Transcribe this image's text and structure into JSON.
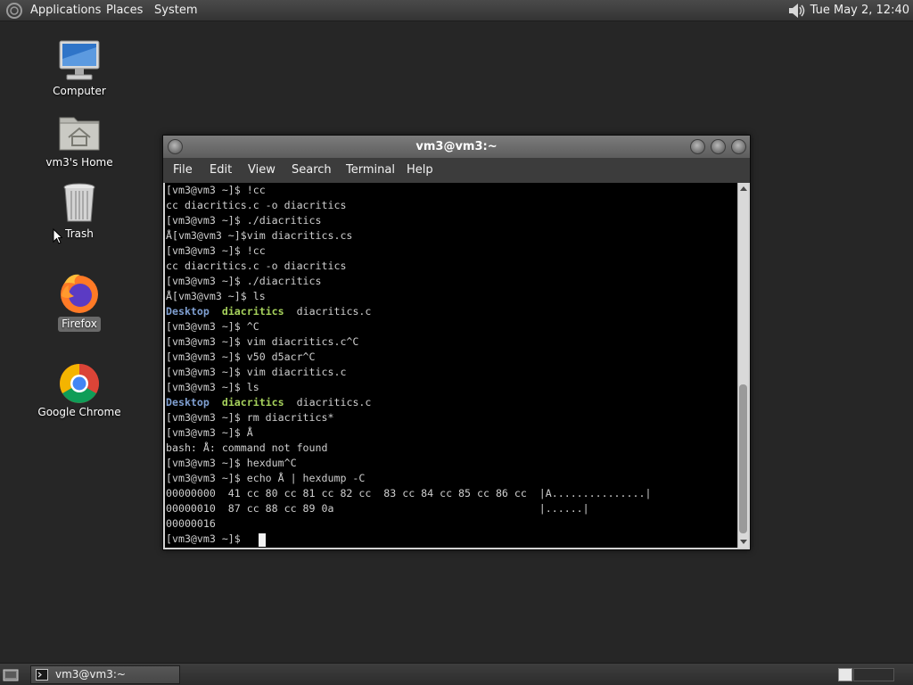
{
  "top_panel": {
    "applications": "Applications",
    "places": "Places",
    "system": "System",
    "clock": "Tue May  2, 12:40"
  },
  "desktop_icons": {
    "computer": "Computer",
    "home": "vm3's Home",
    "trash": "Trash",
    "firefox": "Firefox",
    "chrome": "Google Chrome"
  },
  "terminal": {
    "title": "vm3@vm3:~",
    "menu": [
      "File",
      "Edit",
      "View",
      "Search",
      "Terminal",
      "Help"
    ],
    "lines": [
      "[vm3@vm3 ~]$ !cc",
      "cc diacritics.c -o diacritics",
      "[vm3@vm3 ~]$ ./diacritics",
      "Å[vm3@vm3 ~]$vim diacritics.cs",
      "[vm3@vm3 ~]$ !cc",
      "cc diacritics.c -o diacritics",
      "[vm3@vm3 ~]$ ./diacritics",
      "Å[vm3@vm3 ~]$ ls",
      "[vm3@vm3 ~]$ ^C",
      "[vm3@vm3 ~]$ vim diacritics.c^C",
      "[vm3@vm3 ~]$ v50 d5acr^C",
      "[vm3@vm3 ~]$ vim diacritics.c",
      "[vm3@vm3 ~]$ ls",
      "[vm3@vm3 ~]$ rm diacritics*",
      "[vm3@vm3 ~]$ Å",
      "bash: Å: command not found",
      "[vm3@vm3 ~]$ hexdum^C",
      "[vm3@vm3 ~]$ echo Å | hexdump -C",
      "00000000  41 cc 80 cc 81 cc 82 cc  83 cc 84 cc 85 cc 86 cc  |A...............|",
      "00000010  87 cc 88 cc 89 0a                                 |......|",
      "00000016",
      "[vm3@vm3 ~]$ "
    ],
    "ls_output": [
      "Desktop",
      "diacritics",
      "diacritics.c"
    ]
  },
  "taskbar": {
    "window_button": "vm3@vm3:~"
  },
  "colors": {
    "desktop_bg": "#262626",
    "ls_directory": "#7f9fd1",
    "ls_executable": "#a6d15c"
  }
}
